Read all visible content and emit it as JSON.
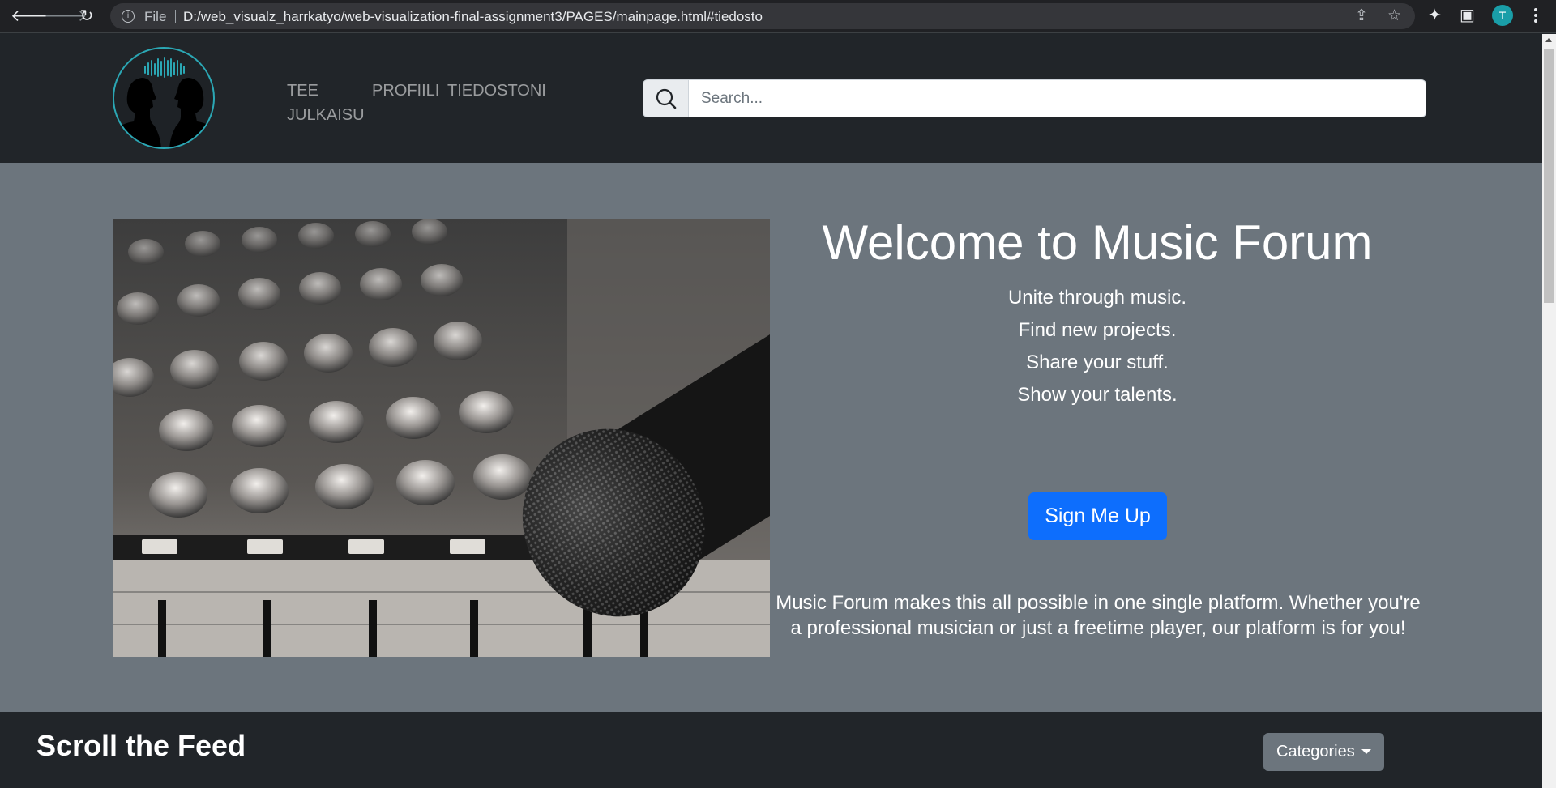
{
  "browser": {
    "back_glyph": "🡐",
    "forward_glyph": "🡒",
    "reload_glyph": "↻",
    "info_glyph": "i",
    "scheme_label": "File",
    "url": "D:/web_visualz_harrkatyo/web-visualization-final-assignment3/PAGES/mainpage.html#tiedosto",
    "share_glyph": "⇪",
    "star_glyph": "☆",
    "extensions_glyph": "✦",
    "sidepanel_glyph": "▣",
    "profile_initial": "T",
    "profile_color": "#1a9ea8"
  },
  "navbar": {
    "links": [
      {
        "line1": "TEE",
        "line2": "JULKAISU"
      },
      {
        "line1": "PROFIILI"
      },
      {
        "line1": "TIEDOSTONI"
      }
    ],
    "search": {
      "placeholder": "Search..."
    }
  },
  "hero": {
    "title": "Welcome to Music Forum",
    "taglines": [
      "Unite through music.",
      "Find new projects.",
      "Share your stuff.",
      "Show your talents."
    ],
    "signup_label": "Sign Me Up",
    "description": "Music Forum makes this all possible in one single platform. Whether you're a professional musician or just a freetime player, our platform is for you!"
  },
  "feed": {
    "title": "Scroll the Feed",
    "categories_label": "Categories"
  },
  "colors": {
    "navbar_bg": "#212529",
    "hero_bg": "#6c757d",
    "primary": "#0d6efd",
    "logo_accent": "#2ba7b4"
  }
}
